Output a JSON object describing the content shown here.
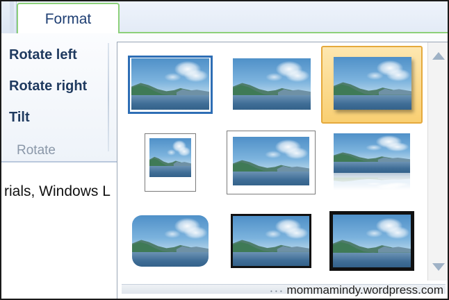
{
  "tabs": {
    "format_label": "Format"
  },
  "ribbon": {
    "rotate_left": "Rotate left",
    "rotate_right": "Rotate right",
    "tilt": "Tilt",
    "group_label": "Rotate"
  },
  "document": {
    "visible_text": "rials, Windows L"
  },
  "gallery": {
    "tiles": [
      {
        "style": "plain",
        "state": "selected"
      },
      {
        "style": "plain",
        "state": "normal"
      },
      {
        "style": "shadow",
        "state": "hover"
      },
      {
        "style": "white-frame-small",
        "state": "normal"
      },
      {
        "style": "white-frame",
        "state": "normal"
      },
      {
        "style": "reflection",
        "state": "normal"
      },
      {
        "style": "rounded",
        "state": "normal"
      },
      {
        "style": "thin-black-frame",
        "state": "normal"
      },
      {
        "style": "thick-black-frame",
        "state": "normal"
      }
    ],
    "scroll_up_icon": "triangle-up",
    "scroll_down_icon": "triangle-down"
  },
  "watermark": "mommamindy.wordpress.com",
  "colors": {
    "tab_accent": "#8cd07a",
    "selection_border": "#2e6eb5",
    "hover_fill": "#f9cf72",
    "ribbon_text": "#1f3a5f"
  }
}
